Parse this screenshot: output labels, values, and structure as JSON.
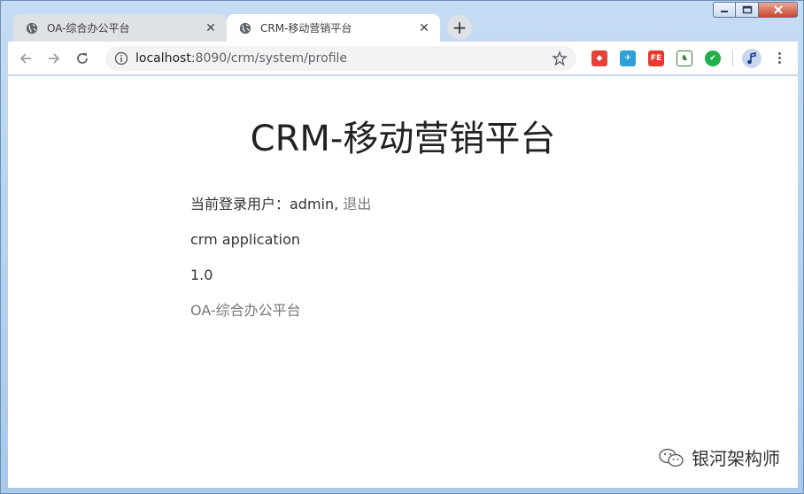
{
  "browser": {
    "tabs": [
      {
        "title": "OA-综合办公平台",
        "active": false
      },
      {
        "title": "CRM-移动营销平台",
        "active": true
      }
    ],
    "address": {
      "host": "localhost",
      "path": ":8090/crm/system/profile"
    },
    "extensions": [
      "tomato-icon",
      "feather-icon",
      "fe-icon",
      "evernote-icon",
      "vue-icon"
    ]
  },
  "page": {
    "title": "CRM-移动营销平台",
    "user_prefix": "当前登录用户：admin, ",
    "logout_label": "退出",
    "app_name": "crm application",
    "version": "1.0",
    "oa_link": "OA-综合办公平台"
  },
  "watermark": {
    "text": "银河架构师"
  },
  "colors": {
    "tab_inactive": "#dee1e6",
    "link": "#777777"
  }
}
